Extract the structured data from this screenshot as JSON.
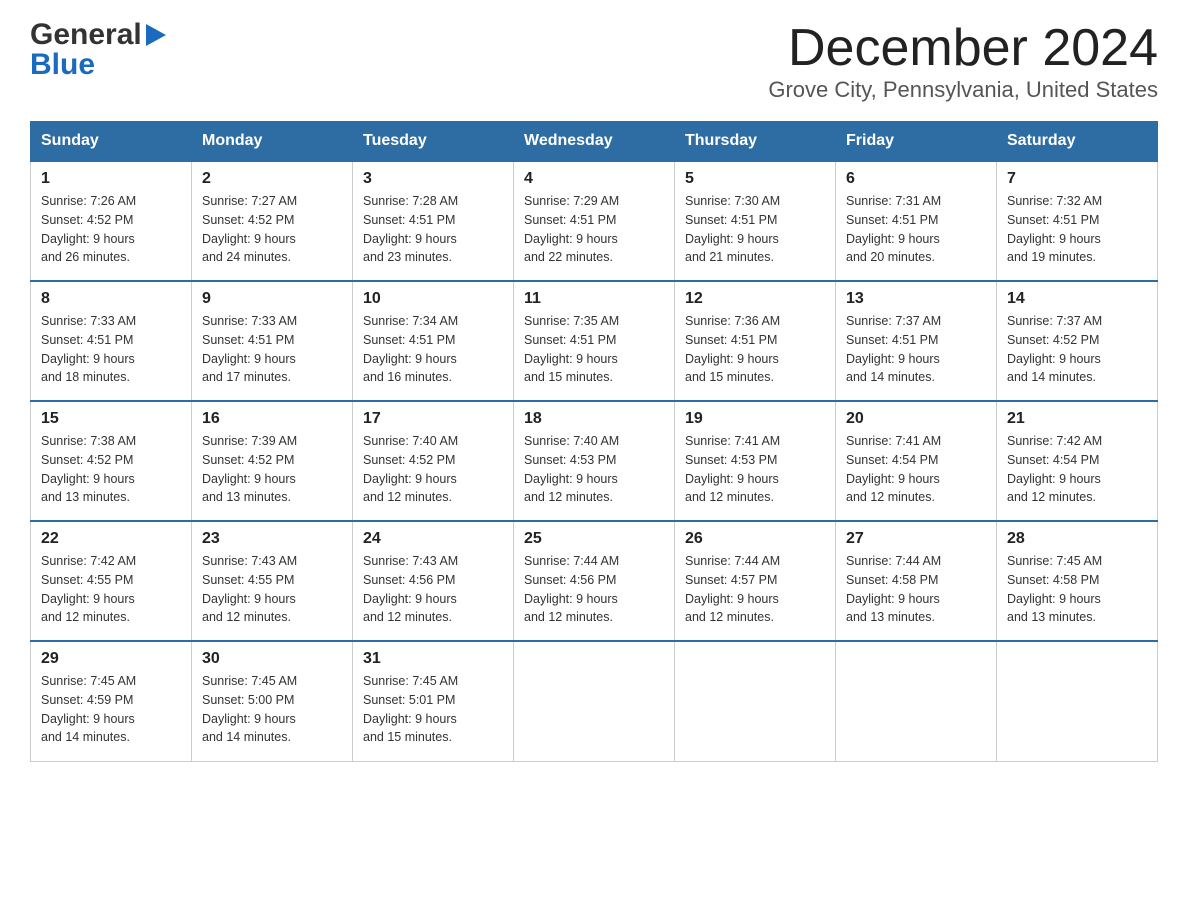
{
  "header": {
    "logo_general": "General",
    "logo_blue": "Blue",
    "month_title": "December 2024",
    "location": "Grove City, Pennsylvania, United States"
  },
  "weekdays": [
    "Sunday",
    "Monday",
    "Tuesday",
    "Wednesday",
    "Thursday",
    "Friday",
    "Saturday"
  ],
  "weeks": [
    [
      {
        "day": "1",
        "sunrise": "7:26 AM",
        "sunset": "4:52 PM",
        "daylight": "9 hours and 26 minutes."
      },
      {
        "day": "2",
        "sunrise": "7:27 AM",
        "sunset": "4:52 PM",
        "daylight": "9 hours and 24 minutes."
      },
      {
        "day": "3",
        "sunrise": "7:28 AM",
        "sunset": "4:51 PM",
        "daylight": "9 hours and 23 minutes."
      },
      {
        "day": "4",
        "sunrise": "7:29 AM",
        "sunset": "4:51 PM",
        "daylight": "9 hours and 22 minutes."
      },
      {
        "day": "5",
        "sunrise": "7:30 AM",
        "sunset": "4:51 PM",
        "daylight": "9 hours and 21 minutes."
      },
      {
        "day": "6",
        "sunrise": "7:31 AM",
        "sunset": "4:51 PM",
        "daylight": "9 hours and 20 minutes."
      },
      {
        "day": "7",
        "sunrise": "7:32 AM",
        "sunset": "4:51 PM",
        "daylight": "9 hours and 19 minutes."
      }
    ],
    [
      {
        "day": "8",
        "sunrise": "7:33 AM",
        "sunset": "4:51 PM",
        "daylight": "9 hours and 18 minutes."
      },
      {
        "day": "9",
        "sunrise": "7:33 AM",
        "sunset": "4:51 PM",
        "daylight": "9 hours and 17 minutes."
      },
      {
        "day": "10",
        "sunrise": "7:34 AM",
        "sunset": "4:51 PM",
        "daylight": "9 hours and 16 minutes."
      },
      {
        "day": "11",
        "sunrise": "7:35 AM",
        "sunset": "4:51 PM",
        "daylight": "9 hours and 15 minutes."
      },
      {
        "day": "12",
        "sunrise": "7:36 AM",
        "sunset": "4:51 PM",
        "daylight": "9 hours and 15 minutes."
      },
      {
        "day": "13",
        "sunrise": "7:37 AM",
        "sunset": "4:51 PM",
        "daylight": "9 hours and 14 minutes."
      },
      {
        "day": "14",
        "sunrise": "7:37 AM",
        "sunset": "4:52 PM",
        "daylight": "9 hours and 14 minutes."
      }
    ],
    [
      {
        "day": "15",
        "sunrise": "7:38 AM",
        "sunset": "4:52 PM",
        "daylight": "9 hours and 13 minutes."
      },
      {
        "day": "16",
        "sunrise": "7:39 AM",
        "sunset": "4:52 PM",
        "daylight": "9 hours and 13 minutes."
      },
      {
        "day": "17",
        "sunrise": "7:40 AM",
        "sunset": "4:52 PM",
        "daylight": "9 hours and 12 minutes."
      },
      {
        "day": "18",
        "sunrise": "7:40 AM",
        "sunset": "4:53 PM",
        "daylight": "9 hours and 12 minutes."
      },
      {
        "day": "19",
        "sunrise": "7:41 AM",
        "sunset": "4:53 PM",
        "daylight": "9 hours and 12 minutes."
      },
      {
        "day": "20",
        "sunrise": "7:41 AM",
        "sunset": "4:54 PM",
        "daylight": "9 hours and 12 minutes."
      },
      {
        "day": "21",
        "sunrise": "7:42 AM",
        "sunset": "4:54 PM",
        "daylight": "9 hours and 12 minutes."
      }
    ],
    [
      {
        "day": "22",
        "sunrise": "7:42 AM",
        "sunset": "4:55 PM",
        "daylight": "9 hours and 12 minutes."
      },
      {
        "day": "23",
        "sunrise": "7:43 AM",
        "sunset": "4:55 PM",
        "daylight": "9 hours and 12 minutes."
      },
      {
        "day": "24",
        "sunrise": "7:43 AM",
        "sunset": "4:56 PM",
        "daylight": "9 hours and 12 minutes."
      },
      {
        "day": "25",
        "sunrise": "7:44 AM",
        "sunset": "4:56 PM",
        "daylight": "9 hours and 12 minutes."
      },
      {
        "day": "26",
        "sunrise": "7:44 AM",
        "sunset": "4:57 PM",
        "daylight": "9 hours and 12 minutes."
      },
      {
        "day": "27",
        "sunrise": "7:44 AM",
        "sunset": "4:58 PM",
        "daylight": "9 hours and 13 minutes."
      },
      {
        "day": "28",
        "sunrise": "7:45 AM",
        "sunset": "4:58 PM",
        "daylight": "9 hours and 13 minutes."
      }
    ],
    [
      {
        "day": "29",
        "sunrise": "7:45 AM",
        "sunset": "4:59 PM",
        "daylight": "9 hours and 14 minutes."
      },
      {
        "day": "30",
        "sunrise": "7:45 AM",
        "sunset": "5:00 PM",
        "daylight": "9 hours and 14 minutes."
      },
      {
        "day": "31",
        "sunrise": "7:45 AM",
        "sunset": "5:01 PM",
        "daylight": "9 hours and 15 minutes."
      },
      null,
      null,
      null,
      null
    ]
  ],
  "labels": {
    "sunrise": "Sunrise:",
    "sunset": "Sunset:",
    "daylight": "Daylight:"
  }
}
